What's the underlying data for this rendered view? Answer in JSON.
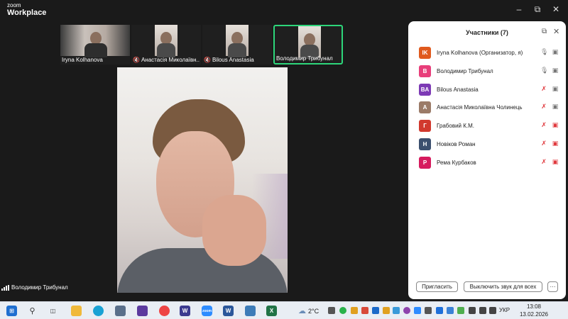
{
  "app": {
    "logo_top": "zoom",
    "logo_bottom": "Workplace"
  },
  "window_controls": [
    "minimize-icon",
    "restore-icon",
    "close-icon"
  ],
  "thumbnails": [
    {
      "name": "Iryna Kolhanova",
      "muted": false,
      "active": false
    },
    {
      "name": "Анастасія Миколаївн...",
      "muted": true,
      "active": false
    },
    {
      "name": "Bilous Anastasia",
      "muted": true,
      "active": false
    },
    {
      "name": "Володимир Трибунал",
      "muted": false,
      "active": true
    }
  ],
  "main_video": {
    "speaker_name": "Володимир Трибунал"
  },
  "participants": {
    "title": "Участники (7)",
    "items": [
      {
        "initials": "IK",
        "color": "#e05a1e",
        "name": "Iryna Kolhanova (Организатор, я)",
        "mic": "on",
        "video": "on"
      },
      {
        "initials": "В",
        "color": "#e83e7a",
        "name": "Володимир Трибунал",
        "mic": "on",
        "video": "on"
      },
      {
        "initials": "BA",
        "color": "#7d3ab5",
        "name": "Bilous Anastasia",
        "mic": "off",
        "video": "on"
      },
      {
        "initials": "А",
        "color": "#9b7b68",
        "name": "Анастасія Миколаївна Чолинець",
        "mic": "off",
        "video": "on"
      },
      {
        "initials": "Г",
        "color": "#d1392e",
        "name": "Грабовий К.М.",
        "mic": "off",
        "video": "off"
      },
      {
        "initials": "Н",
        "color": "#3b4f6e",
        "name": "Новіков Роман",
        "mic": "off",
        "video": "off"
      },
      {
        "initials": "Р",
        "color": "#d61b5e",
        "name": "Рема Курбаков",
        "mic": "off",
        "video": "off"
      }
    ],
    "invite_label": "Пригласить",
    "mute_all_label": "Выключить звук для всех",
    "more_label": "···"
  },
  "taskbar": {
    "weather_temp": "2°C",
    "language": "УКР",
    "time": "13:08",
    "date": "13.02.2026"
  }
}
